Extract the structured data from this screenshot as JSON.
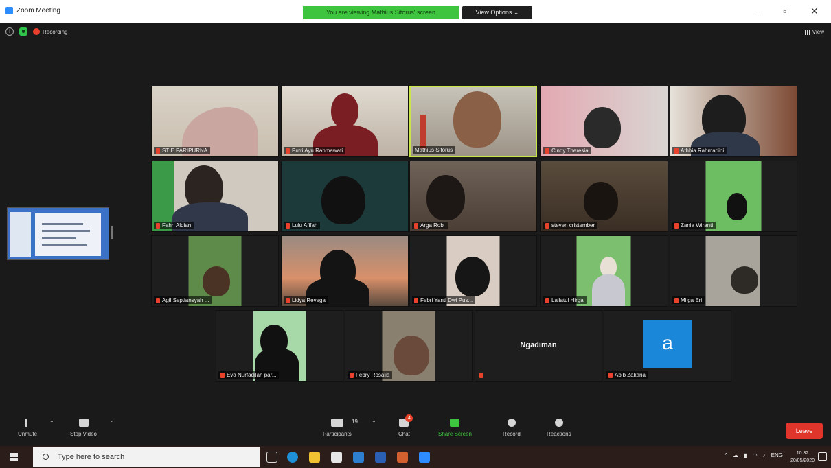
{
  "window": {
    "title": "Zoom Meeting",
    "banner": "You are viewing Mathius Sitorus' screen",
    "view_options": "View Options ⌄"
  },
  "meeting": {
    "recording_label": "Recording",
    "view_label": "View"
  },
  "participants": [
    {
      "name": "STIE PARIPURNA"
    },
    {
      "name": "Putri Ayu Rahmawati"
    },
    {
      "name": "Mathius Sitorus"
    },
    {
      "name": "Cindy Theresia"
    },
    {
      "name": "Athhia Rahmadini"
    },
    {
      "name": "Fahri Aldian"
    },
    {
      "name": "Lulu Afifah"
    },
    {
      "name": "Arga Robi"
    },
    {
      "name": "steven cristember"
    },
    {
      "name": "Zania Wiranti"
    },
    {
      "name": "Agil Septiansyah ..."
    },
    {
      "name": "Lidya Revega"
    },
    {
      "name": "Febri Yanti Dwi Pus..."
    },
    {
      "name": "Lailatul Hirga"
    },
    {
      "name": "Milga Eri"
    },
    {
      "name": "Eva Nurfadilah par..."
    },
    {
      "name": "Febry Rosalia"
    },
    {
      "name": "Ngadiman"
    },
    {
      "name": "Abib Zakaria",
      "avatar_letter": "a"
    }
  ],
  "toolbar": {
    "unmute": "Unmute",
    "stop_video": "Stop Video",
    "participants": "Participants",
    "participants_count": "19",
    "chat": "Chat",
    "chat_badge": "4",
    "share_screen": "Share Screen",
    "record": "Record",
    "reactions": "Reactions",
    "leave": "Leave"
  },
  "taskbar": {
    "search_placeholder": "Type here to search",
    "language": "ENG",
    "time": "10:32",
    "date": "20/05/2020"
  },
  "colors": {
    "banner_green": "#3ec43e",
    "leave_red": "#e0352b",
    "active_speaker": "#c8e64a",
    "avatar_blue": "#1a87d8"
  }
}
